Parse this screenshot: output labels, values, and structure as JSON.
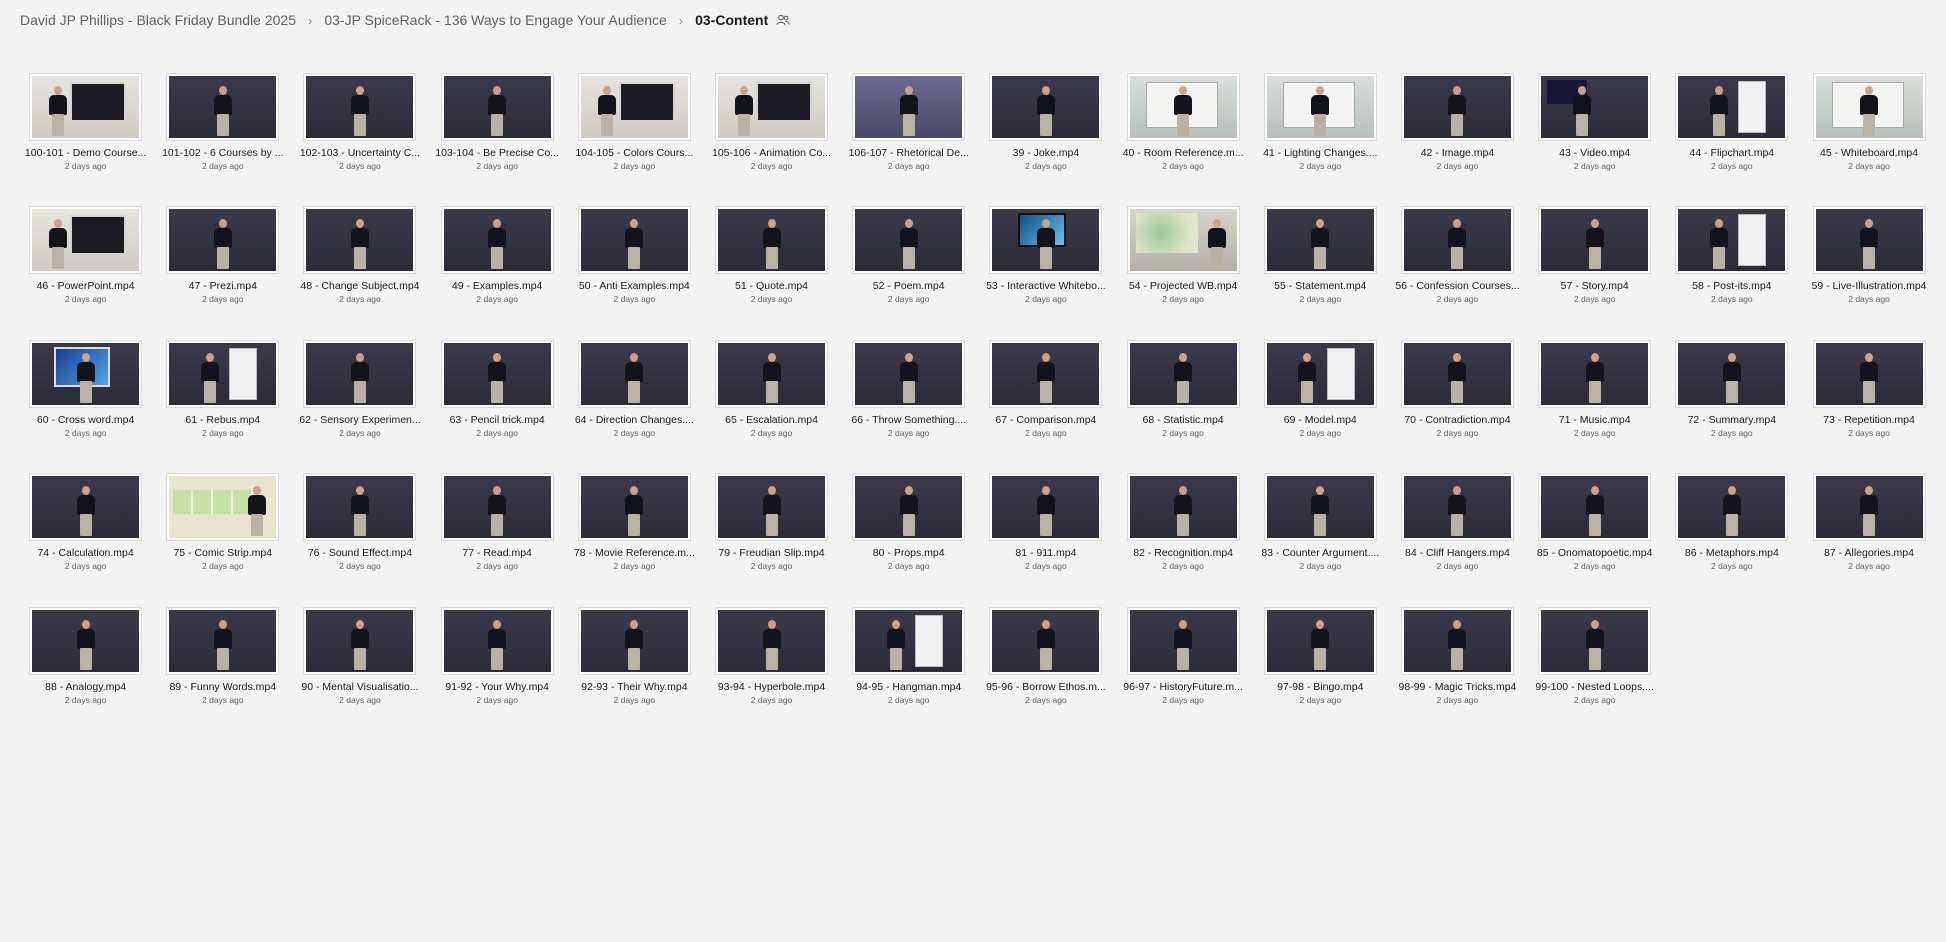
{
  "breadcrumb": {
    "items": [
      {
        "label": "David JP Phillips - Black Friday Bundle 2025"
      },
      {
        "label": "03-JP SpiceRack - 136 Ways to Engage Your Audience"
      },
      {
        "label": "03-Content"
      }
    ],
    "separator": "›",
    "shared_icon": "people-icon"
  },
  "files": [
    {
      "name": "100-101 - Demo Course...",
      "date": "2 days ago",
      "thumb": "screen"
    },
    {
      "name": "101-102 - 6 Courses by ...",
      "date": "2 days ago",
      "thumb": "plain"
    },
    {
      "name": "102-103 - Uncertainty C...",
      "date": "2 days ago",
      "thumb": "plain"
    },
    {
      "name": "103-104 - Be Precise Co...",
      "date": "2 days ago",
      "thumb": "plain"
    },
    {
      "name": "104-105 - Colors Cours...",
      "date": "2 days ago",
      "thumb": "screen"
    },
    {
      "name": "105-106 - Animation Co...",
      "date": "2 days ago",
      "thumb": "screen"
    },
    {
      "name": "106-107 - Rhetorical De...",
      "date": "2 days ago",
      "thumb": "purple"
    },
    {
      "name": "39 - Joke.mp4",
      "date": "2 days ago",
      "thumb": "plain"
    },
    {
      "name": "40 - Room Reference.m...",
      "date": "2 days ago",
      "thumb": "white"
    },
    {
      "name": "41 - Lighting Changes....",
      "date": "2 days ago",
      "thumb": "white"
    },
    {
      "name": "42 - Image.mp4",
      "date": "2 days ago",
      "thumb": "plain"
    },
    {
      "name": "43 - Video.mp4",
      "date": "2 days ago",
      "thumb": "dark"
    },
    {
      "name": "44 - Flipchart.mp4",
      "date": "2 days ago",
      "thumb": "flip"
    },
    {
      "name": "45 - Whiteboard.mp4",
      "date": "2 days ago",
      "thumb": "white"
    },
    {
      "name": "46 - PowerPoint.mp4",
      "date": "2 days ago",
      "thumb": "screen"
    },
    {
      "name": "47 - Prezi.mp4",
      "date": "2 days ago",
      "thumb": "plain"
    },
    {
      "name": "48 - Change Subject.mp4",
      "date": "2 days ago",
      "thumb": "plain"
    },
    {
      "name": "49 - Examples.mp4",
      "date": "2 days ago",
      "thumb": "plain"
    },
    {
      "name": "50 - Anti Examples.mp4",
      "date": "2 days ago",
      "thumb": "plain"
    },
    {
      "name": "51 - Quote.mp4",
      "date": "2 days ago",
      "thumb": "plain"
    },
    {
      "name": "52 - Poem.mp4",
      "date": "2 days ago",
      "thumb": "plain"
    },
    {
      "name": "53 - Interactive Whitebo...",
      "date": "2 days ago",
      "thumb": "tv"
    },
    {
      "name": "54 - Projected WB.mp4",
      "date": "2 days ago",
      "thumb": "green"
    },
    {
      "name": "55 - Statement.mp4",
      "date": "2 days ago",
      "thumb": "plain"
    },
    {
      "name": "56 - Confession Courses...",
      "date": "2 days ago",
      "thumb": "plain"
    },
    {
      "name": "57 - Story.mp4",
      "date": "2 days ago",
      "thumb": "plain"
    },
    {
      "name": "58 - Post-its.mp4",
      "date": "2 days ago",
      "thumb": "flip"
    },
    {
      "name": "59 - Live-Illustration.mp4",
      "date": "2 days ago",
      "thumb": "plain"
    },
    {
      "name": "60 - Cross word.mp4",
      "date": "2 days ago",
      "thumb": "blue"
    },
    {
      "name": "61 - Rebus.mp4",
      "date": "2 days ago",
      "thumb": "flip"
    },
    {
      "name": "62 - Sensory Experimen...",
      "date": "2 days ago",
      "thumb": "plain"
    },
    {
      "name": "63 - Pencil trick.mp4",
      "date": "2 days ago",
      "thumb": "plain"
    },
    {
      "name": "64 - Direction Changes....",
      "date": "2 days ago",
      "thumb": "plain"
    },
    {
      "name": "65 - Escalation.mp4",
      "date": "2 days ago",
      "thumb": "plain"
    },
    {
      "name": "66 - Throw Something....",
      "date": "2 days ago",
      "thumb": "plain"
    },
    {
      "name": "67 - Comparison.mp4",
      "date": "2 days ago",
      "thumb": "plain"
    },
    {
      "name": "68 - Statistic.mp4",
      "date": "2 days ago",
      "thumb": "plain"
    },
    {
      "name": "69 - Model.mp4",
      "date": "2 days ago",
      "thumb": "flip"
    },
    {
      "name": "70 - Contradiction.mp4",
      "date": "2 days ago",
      "thumb": "plain"
    },
    {
      "name": "71 - Music.mp4",
      "date": "2 days ago",
      "thumb": "plain"
    },
    {
      "name": "72 - Summary.mp4",
      "date": "2 days ago",
      "thumb": "plain"
    },
    {
      "name": "73 - Repetition.mp4",
      "date": "2 days ago",
      "thumb": "plain"
    },
    {
      "name": "74 - Calculation.mp4",
      "date": "2 days ago",
      "thumb": "plain"
    },
    {
      "name": "75 - Comic Strip.mp4",
      "date": "2 days ago",
      "thumb": "comic"
    },
    {
      "name": "76 - Sound Effect.mp4",
      "date": "2 days ago",
      "thumb": "plain"
    },
    {
      "name": "77 - Read.mp4",
      "date": "2 days ago",
      "thumb": "plain"
    },
    {
      "name": "78 - Movie Reference.m...",
      "date": "2 days ago",
      "thumb": "plain"
    },
    {
      "name": "79 - Freudian Slip.mp4",
      "date": "2 days ago",
      "thumb": "plain"
    },
    {
      "name": "80 - Props.mp4",
      "date": "2 days ago",
      "thumb": "plain"
    },
    {
      "name": "81 - 911.mp4",
      "date": "2 days ago",
      "thumb": "plain"
    },
    {
      "name": "82 - Recognition.mp4",
      "date": "2 days ago",
      "thumb": "plain"
    },
    {
      "name": "83 - Counter Argument....",
      "date": "2 days ago",
      "thumb": "plain"
    },
    {
      "name": "84 - Cliff Hangers.mp4",
      "date": "2 days ago",
      "thumb": "plain"
    },
    {
      "name": "85 - Onomatopoetic.mp4",
      "date": "2 days ago",
      "thumb": "plain"
    },
    {
      "name": "86 - Metaphors.mp4",
      "date": "2 days ago",
      "thumb": "plain"
    },
    {
      "name": "87 - Allegories.mp4",
      "date": "2 days ago",
      "thumb": "plain"
    },
    {
      "name": "88 - Analogy.mp4",
      "date": "2 days ago",
      "thumb": "plain"
    },
    {
      "name": "89 - Funny Words.mp4",
      "date": "2 days ago",
      "thumb": "plain"
    },
    {
      "name": "90 - Mental Visualisatio...",
      "date": "2 days ago",
      "thumb": "plain"
    },
    {
      "name": "91-92 - Your Why.mp4",
      "date": "2 days ago",
      "thumb": "plain"
    },
    {
      "name": "92-93 - Their Why.mp4",
      "date": "2 days ago",
      "thumb": "plain"
    },
    {
      "name": "93-94 - Hyperbole.mp4",
      "date": "2 days ago",
      "thumb": "plain"
    },
    {
      "name": "94-95 - Hangman.mp4",
      "date": "2 days ago",
      "thumb": "flip"
    },
    {
      "name": "95-96 - Borrow Ethos.m...",
      "date": "2 days ago",
      "thumb": "plain"
    },
    {
      "name": "96-97 - HistoryFuture.m...",
      "date": "2 days ago",
      "thumb": "plain"
    },
    {
      "name": "97-98 - Bingo.mp4",
      "date": "2 days ago",
      "thumb": "plain"
    },
    {
      "name": "98-99 - Magic Tricks.mp4",
      "date": "2 days ago",
      "thumb": "plain"
    },
    {
      "name": "99-100 - Nested Loops....",
      "date": "2 days ago",
      "thumb": "plain"
    }
  ]
}
